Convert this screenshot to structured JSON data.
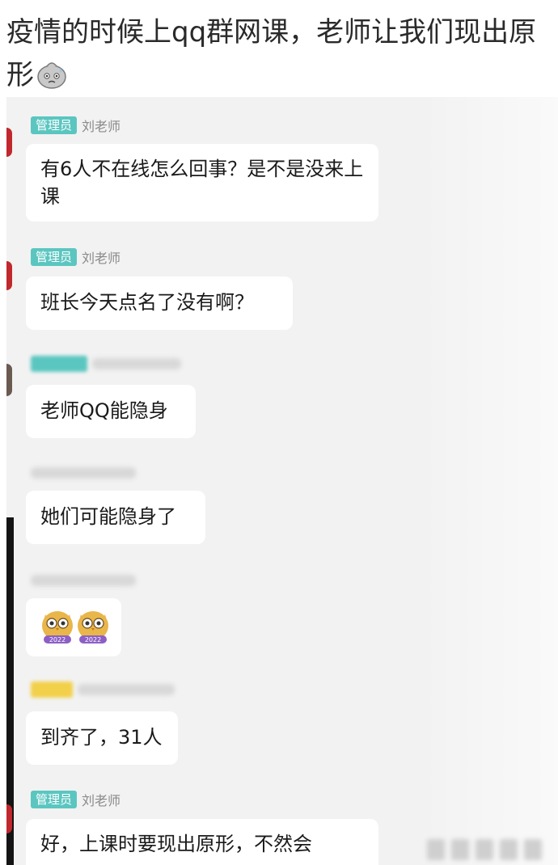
{
  "post": {
    "title": "疫情的时候上qq群网课，老师让我们现出原形"
  },
  "chat": {
    "messages": [
      {
        "badge": "管理员",
        "sender": "刘老师",
        "text": "有6人不在线怎么回事？是不是没来上课"
      },
      {
        "badge": "管理员",
        "sender": "刘老师",
        "text": "班长今天点名了没有啊？"
      },
      {
        "text": "老师QQ能隐身"
      },
      {
        "text": "她们可能隐身了"
      },
      {
        "sticker_labels": [
          "2022",
          "2022"
        ]
      },
      {
        "text": "到齐了，31人"
      },
      {
        "badge": "管理员",
        "sender": "刘老师",
        "text": "好，上课时要现出原形，不然会"
      }
    ]
  },
  "colors": {
    "admin_badge": "#5bc6c0",
    "bubble": "#ffffff",
    "chat_bg": "#f2f2f2"
  }
}
